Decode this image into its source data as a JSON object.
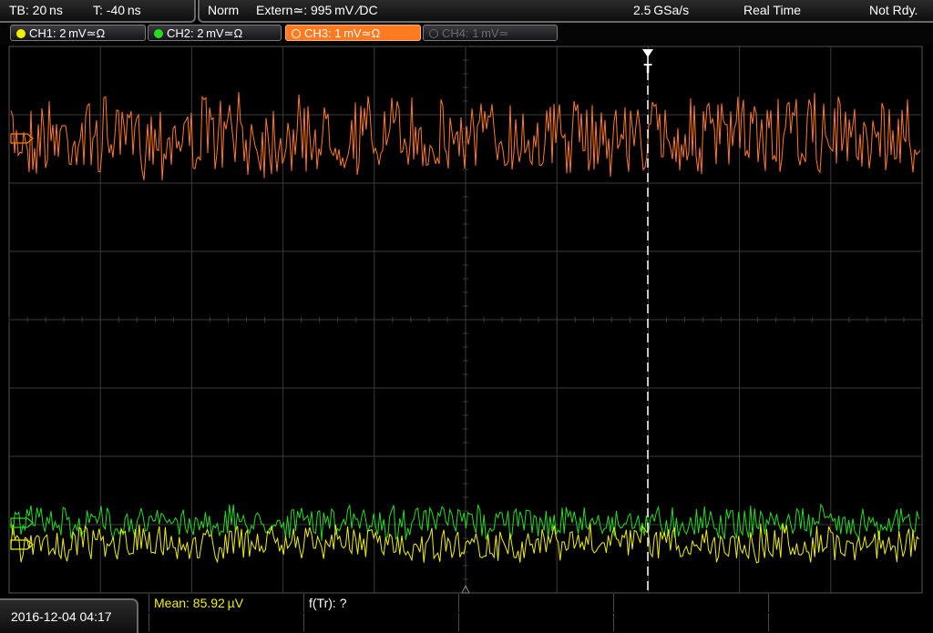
{
  "header": {
    "timebase": "TB: 20 ns",
    "trigger_time": "T: -40 ns",
    "mode": "Norm",
    "trigger_source": "Extern≃: 995 mV ∕DC",
    "sample_rate": "2.5 GSa/s",
    "acq_mode": "Real Time",
    "status": "Not Rdy."
  },
  "channels": [
    {
      "label": "CH1: 2 mV≃Ω",
      "color": "#f0f000",
      "active": true
    },
    {
      "label": "CH2: 2 mV≃Ω",
      "color": "#22dd22",
      "active": true
    },
    {
      "label": "CH3: 1 mV≃Ω",
      "color": "#ff7a20",
      "active": true,
      "selected": true
    },
    {
      "label": "CH4: 1 mV≃",
      "color": "#6a6a6a",
      "active": false
    }
  ],
  "footer": {
    "datetime": "2016-12-04 04:17",
    "measurement_1": "Mean: 85.92 µV",
    "measurement_2": "f(Tr): ?"
  },
  "colors": {
    "grid": "#3a3a3a",
    "ch1": "#f0f000",
    "ch2": "#22dd22",
    "ch3": "#ff7a20",
    "trigger_marker": "#ffffff"
  },
  "icons": {
    "trigger_marker": "trigger-arrow-icon",
    "ground_marker": "channel-ground-marker-icon"
  }
}
